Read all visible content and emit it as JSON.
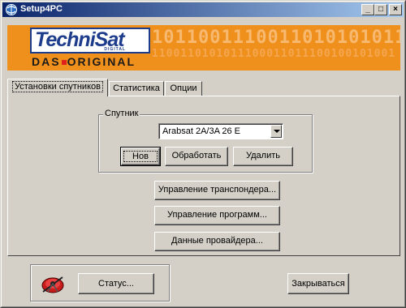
{
  "window": {
    "title": "Setup4PC"
  },
  "titlebar_buttons": {
    "minimize": "_",
    "maximize": "□",
    "close": "×"
  },
  "banner": {
    "logo_text": "TechniSat",
    "logo_sub": "DIGITAL",
    "tagline_left": "DAS",
    "tagline_right": "ORIGINAL",
    "binary_line1": "1011001110011010101011",
    "binary_line2": "1100110101011100011011100100101001"
  },
  "tabs": [
    {
      "label": "Установки спутников",
      "active": true
    },
    {
      "label": "Статистика",
      "active": false
    },
    {
      "label": "Опции",
      "active": false
    }
  ],
  "satellite_group": {
    "label": "Спутник",
    "selected_satellite": "Arabsat 2A/3A 26 E",
    "buttons": {
      "new": "Нов",
      "process": "Обработать",
      "delete": "Удалить"
    }
  },
  "actions": {
    "transponder": "Управление транспондера...",
    "programs": "Управление программ...",
    "provider": "Данные провайдера..."
  },
  "footer": {
    "status_button": "Статус...",
    "close_button": "Закрываться"
  }
}
